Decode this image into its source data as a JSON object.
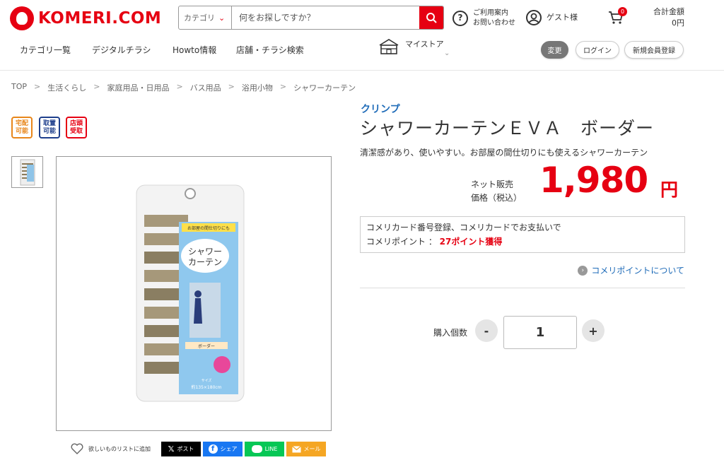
{
  "header": {
    "logo_text": "KOMERI.COM",
    "search": {
      "category_label": "カテゴリ",
      "placeholder": "何をお探しですか？"
    },
    "help": {
      "line1": "ご利用案内",
      "line2": "お問い合わせ"
    },
    "guest_label": "ゲスト様",
    "cart_count": "0",
    "total": {
      "label": "合計金額",
      "value": "0円"
    }
  },
  "nav": {
    "items": [
      "カテゴリ一覧",
      "デジタルチラシ",
      "Howto情報",
      "店舗・チラシ検索"
    ],
    "mystore_label": "マイストア",
    "change_label": "変更",
    "login_label": "ログイン",
    "register_label": "新規会員登録"
  },
  "breadcrumb": [
    "TOP",
    "生活くらし",
    "家庭用品・日用品",
    "バス用品",
    "浴用小物",
    "シャワーカーテン"
  ],
  "badges": [
    {
      "line1": "宅配",
      "line2": "可能",
      "color": "#e8861a"
    },
    {
      "line1": "取置",
      "line2": "可能",
      "color": "#1e3f8c"
    },
    {
      "line1": "店頭",
      "line2": "受取",
      "color": "#e60012"
    }
  ],
  "product": {
    "brand": "クリンプ",
    "title": "シャワーカーテンＥＶＡ　ボーダー",
    "description": "清潔感があり、使いやすい。お部屋の間仕切りにも使えるシャワーカーテン",
    "price_label_1": "ネット販売",
    "price_label_2": "価格（税込）",
    "price": "1,980",
    "price_unit": "円",
    "package": {
      "banner": "お部屋の間仕切りにも",
      "name_1": "シャワー",
      "name_2": "カーテン",
      "pattern": "ボーダー",
      "size_label": "サイズ",
      "size": "約135×180cm"
    }
  },
  "points": {
    "line1": "コメリカード番号登録、コメリカードでお支払いで",
    "line2_prefix": "コメリポイント ： ",
    "line2_value": "27ポイント獲得",
    "about_link": "コメリポイントについて"
  },
  "quantity": {
    "label": "購入個数",
    "value": "1",
    "minus": "-",
    "plus": "+"
  },
  "share": {
    "wishlist_label": "欲しいものリストに追加",
    "buttons": [
      {
        "label": "ポスト",
        "color": "#000000"
      },
      {
        "label": "シェア",
        "color": "#1877f2"
      },
      {
        "label": "LINE",
        "color": "#06c755"
      },
      {
        "label": "メール",
        "color": "#f5a623"
      }
    ]
  },
  "colors": {
    "accent": "#e60012",
    "link": "#1e6bb8"
  }
}
